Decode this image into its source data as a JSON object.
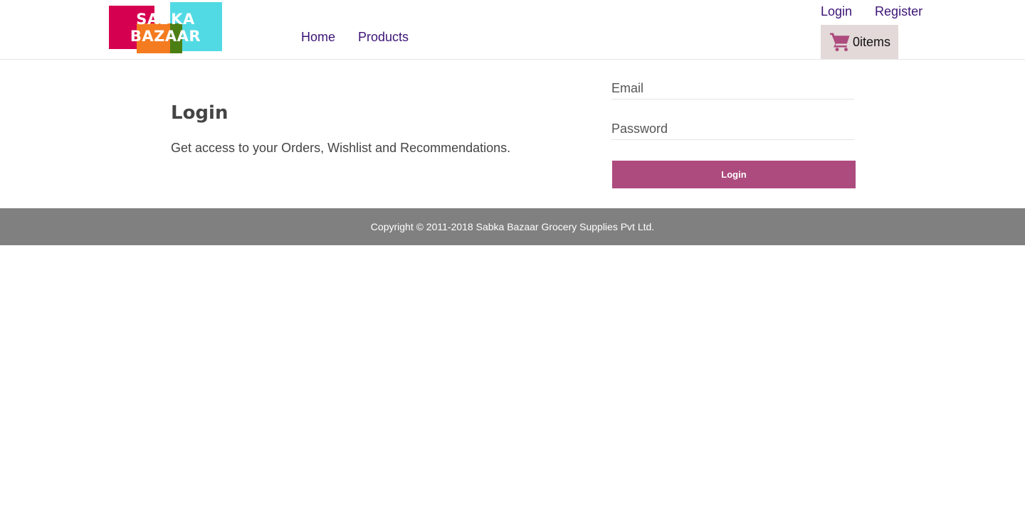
{
  "header": {
    "logo": {
      "line1": "SABKA",
      "line2": "BAZAAR"
    },
    "nav": {
      "home": "Home",
      "products": "Products"
    },
    "auth": {
      "login": "Login",
      "register": "Register"
    },
    "cart": {
      "count_text": "0items",
      "icon": "cart-icon",
      "icon_color": "#ad4b7e"
    }
  },
  "main": {
    "title": "Login",
    "subtitle": "Get access to your Orders, Wishlist and Recommendations.",
    "form": {
      "email_placeholder": "Email",
      "password_placeholder": "Password",
      "submit_label": "Login"
    }
  },
  "footer": {
    "copyright": "Copyright © 2011-2018 Sabka Bazaar Grocery Supplies Pvt Ltd."
  },
  "colors": {
    "accent": "#ad4b7e",
    "nav_text": "#3c1476",
    "footer_bg": "#808080",
    "cart_bg": "#e3d9d9"
  }
}
